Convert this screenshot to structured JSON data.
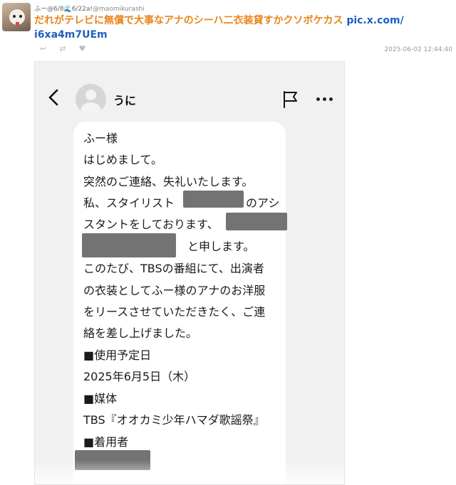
{
  "tweet": {
    "user_name": "ふー@6/8🌊6/22a!",
    "handle": "@maomikurashi",
    "text": "だれがテレビに無償で大事なアナのシーハ二衣装貸すかクソボケカス ",
    "link_part1": "pic.x.com/",
    "link_part2": "i6xa4m7UEm",
    "timestamp": "2025-06-02 12:44:40",
    "actions": [
      "reply-icon",
      "retweet-icon",
      "like-icon"
    ]
  },
  "screenshot": {
    "contact_name": "うに",
    "message_lines": [
      "ふー様",
      "はじめまして。",
      "突然のご連絡、失礼いたします。",
      "私、スタイリスト",
      "のアシ",
      "スタントをしております、",
      "と申します。",
      "このたび、TBSの番組にて、出演者",
      "の衣装としてふー様のアナのお洋服",
      "をリースさせていただきたく、ご連",
      "絡を差し上げました。",
      "■使用予定日",
      "2025年6月5日（木）",
      "■媒体",
      "TBS『オオカミ少年ハマダ歌謡祭』",
      "■着用者"
    ]
  }
}
